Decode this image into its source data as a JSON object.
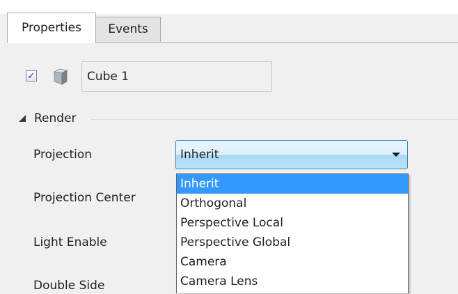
{
  "tabs": [
    {
      "label": "Properties",
      "active": true
    },
    {
      "label": "Events",
      "active": false
    }
  ],
  "object": {
    "enabled": true,
    "icon": "cube-icon",
    "name": "Cube 1"
  },
  "section": {
    "title": "Render",
    "collapsed": false
  },
  "properties": [
    {
      "label": "Projection"
    },
    {
      "label": "Projection Center"
    },
    {
      "label": "Light Enable"
    },
    {
      "label": "Double Side"
    }
  ],
  "projection_combo": {
    "value": "Inherit",
    "options": [
      "Inherit",
      "Orthogonal",
      "Perspective Local",
      "Perspective Global",
      "Camera",
      "Camera Lens"
    ],
    "highlighted_index": 0
  },
  "colors": {
    "selection": "#3399ff",
    "combo_border": "#3c7fb1"
  }
}
